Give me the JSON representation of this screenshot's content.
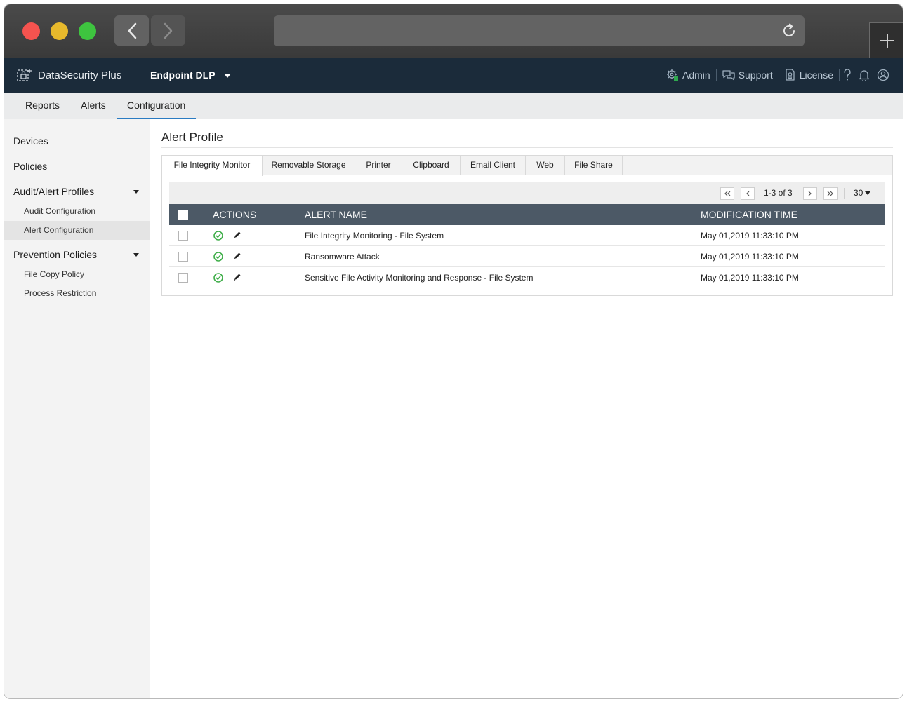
{
  "app": {
    "brand": "DataSecurity Plus",
    "product": "Endpoint DLP",
    "header_links": [
      {
        "label": "Admin",
        "icon": "admin-gear-icon"
      },
      {
        "label": "Support",
        "icon": "chat-icon"
      },
      {
        "label": "License",
        "icon": "license-icon"
      }
    ]
  },
  "mainnav": {
    "tabs": [
      "Reports",
      "Alerts",
      "Configuration"
    ],
    "active": "Configuration"
  },
  "sidebar": {
    "devices": "Devices",
    "policies": "Policies",
    "audit_alert_profiles": "Audit/Alert Profiles",
    "audit_configuration": "Audit Configuration",
    "alert_configuration": "Alert Configuration",
    "prevention_policies": "Prevention Policies",
    "file_copy_policy": "File Copy Policy",
    "process_restriction": "Process Restriction",
    "active": "Alert Configuration"
  },
  "page": {
    "title": "Alert Profile",
    "tabs": [
      "File Integrity Monitor",
      "Removable Storage",
      "Printer",
      "Clipboard",
      "Email Client",
      "Web",
      "File Share"
    ],
    "active_tab": "File Integrity Monitor",
    "pagination": {
      "range": "1-3 of 3",
      "per_page": "30"
    },
    "table": {
      "columns": {
        "actions": "ACTIONS",
        "alert_name": "ALERT NAME",
        "modification_time": "MODIFICATION TIME"
      },
      "rows": [
        {
          "alert_name": "File Integrity Monitoring - File System",
          "modification_time": "May 01,2019 11:33:10 PM",
          "status": "enabled"
        },
        {
          "alert_name": "Ransomware Attack",
          "modification_time": "May 01,2019 11:33:10 PM",
          "status": "enabled"
        },
        {
          "alert_name": "Sensitive File Activity Monitoring and Response - File System",
          "modification_time": "May 01,2019 11:33:10 PM",
          "status": "enabled"
        }
      ]
    }
  },
  "colors": {
    "header_bg": "#1b2b3a",
    "table_header_bg": "#4c5966",
    "accent": "#2a7bc2",
    "enabled_green": "#3fae49"
  }
}
